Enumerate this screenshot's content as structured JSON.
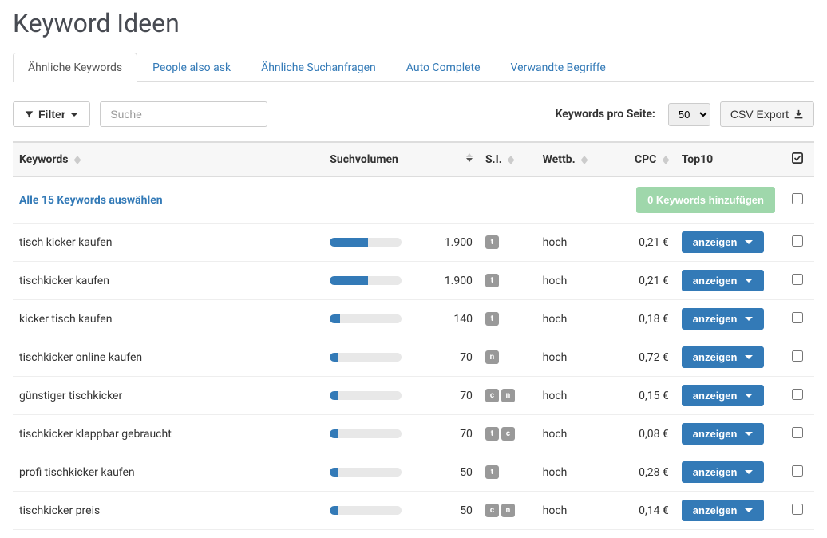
{
  "title": "Keyword Ideen",
  "tabs": [
    {
      "label": "Ähnliche Keywords",
      "active": true
    },
    {
      "label": "People also ask",
      "active": false
    },
    {
      "label": "Ähnliche Suchanfragen",
      "active": false
    },
    {
      "label": "Auto Complete",
      "active": false
    },
    {
      "label": "Verwandte Begriffe",
      "active": false
    }
  ],
  "toolbar": {
    "filter_label": "Filter",
    "search_placeholder": "Suche",
    "per_page_label": "Keywords pro Seite:",
    "per_page_value": "50",
    "csv_label": "CSV Export"
  },
  "columns": {
    "keywords": "Keywords",
    "volume": "Suchvolumen",
    "si": "S.I.",
    "wettb": "Wettb.",
    "cpc": "CPC",
    "top10": "Top10"
  },
  "select_all_label": "Alle 15 Keywords auswählen",
  "add_button_label": "0 Keywords hinzufügen",
  "show_label": "anzeigen",
  "max_volume": 1900,
  "rows": [
    {
      "keyword": "tisch kicker kaufen",
      "volume": "1.900",
      "vol_pct": 53,
      "si": [
        "t"
      ],
      "wettb": "hoch",
      "cpc": "0,21 €"
    },
    {
      "keyword": "tischkicker kaufen",
      "volume": "1.900",
      "vol_pct": 53,
      "si": [
        "t"
      ],
      "wettb": "hoch",
      "cpc": "0,21 €"
    },
    {
      "keyword": "kicker tisch kaufen",
      "volume": "140",
      "vol_pct": 14,
      "si": [
        "t"
      ],
      "wettb": "hoch",
      "cpc": "0,18 €"
    },
    {
      "keyword": "tischkicker online kaufen",
      "volume": "70",
      "vol_pct": 12,
      "si": [
        "n"
      ],
      "wettb": "hoch",
      "cpc": "0,72 €"
    },
    {
      "keyword": "günstiger tischkicker",
      "volume": "70",
      "vol_pct": 12,
      "si": [
        "c",
        "n"
      ],
      "wettb": "hoch",
      "cpc": "0,15 €"
    },
    {
      "keyword": "tischkicker klappbar gebraucht",
      "volume": "70",
      "vol_pct": 12,
      "si": [
        "t",
        "c"
      ],
      "wettb": "hoch",
      "cpc": "0,08 €"
    },
    {
      "keyword": "profi tischkicker kaufen",
      "volume": "50",
      "vol_pct": 11,
      "si": [
        "t"
      ],
      "wettb": "hoch",
      "cpc": "0,28 €"
    },
    {
      "keyword": "tischkicker preis",
      "volume": "50",
      "vol_pct": 11,
      "si": [
        "c",
        "n"
      ],
      "wettb": "hoch",
      "cpc": "0,14 €"
    }
  ]
}
